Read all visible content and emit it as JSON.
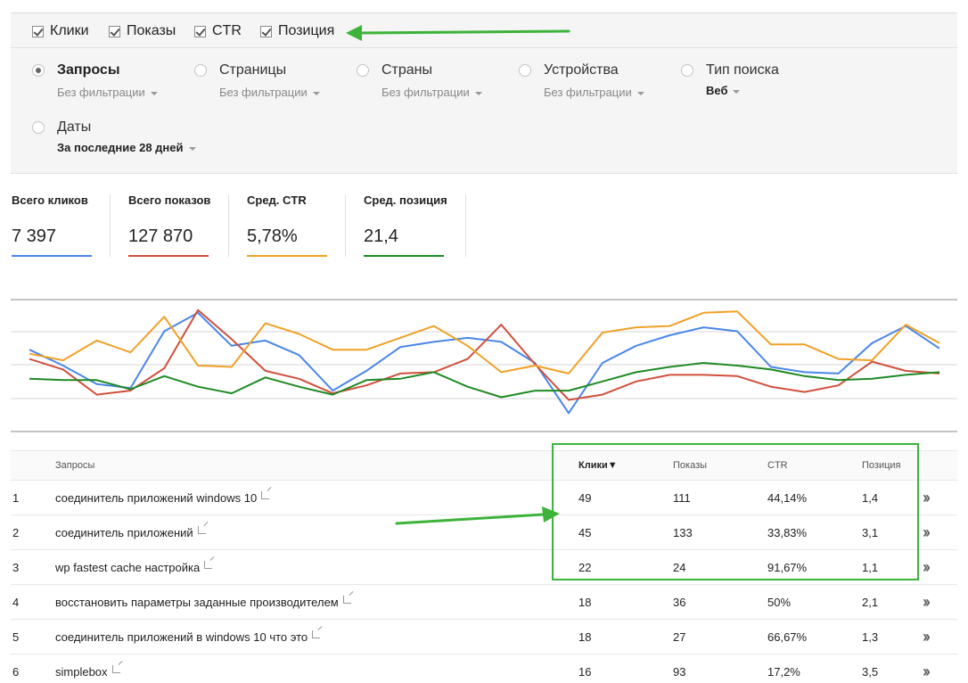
{
  "metrics": [
    {
      "label": "Клики",
      "checked": true
    },
    {
      "label": "Показы",
      "checked": true
    },
    {
      "label": "CTR",
      "checked": true
    },
    {
      "label": "Позиция",
      "checked": true
    }
  ],
  "dimensions": [
    {
      "label": "Запросы",
      "sub": "Без фильтрации",
      "selected": true
    },
    {
      "label": "Страницы",
      "sub": "Без фильтрации",
      "selected": false
    },
    {
      "label": "Страны",
      "sub": "Без фильтрации",
      "selected": false
    },
    {
      "label": "Устройства",
      "sub": "Без фильтрации",
      "selected": false
    },
    {
      "label": "Тип поиска",
      "sub": "Веб",
      "selected": false
    },
    {
      "label": "Даты",
      "sub": "За последние 28 дней",
      "selected": false
    }
  ],
  "totals": [
    {
      "label": "Всего кликов",
      "value": "7 397",
      "color": "#4a86e8"
    },
    {
      "label": "Всего показов",
      "value": "127 870",
      "color": "#d0503e"
    },
    {
      "label": "Сред. CTR",
      "value": "5,78%",
      "color": "#f0a127"
    },
    {
      "label": "Сред. позиция",
      "value": "21,4",
      "color": "#1f8a24"
    }
  ],
  "chart_data": {
    "type": "line",
    "x": [
      1,
      2,
      3,
      4,
      5,
      6,
      7,
      8,
      9,
      10,
      11,
      12,
      13,
      14,
      15,
      16,
      17,
      18,
      19,
      20,
      21,
      22,
      23,
      24,
      25,
      26,
      27,
      28
    ],
    "series": [
      {
        "name": "Клики",
        "color": "#4a86e8",
        "values": [
          0.62,
          0.5,
          0.36,
          0.33,
          0.76,
          0.9,
          0.65,
          0.69,
          0.58,
          0.31,
          0.46,
          0.64,
          0.68,
          0.71,
          0.68,
          0.52,
          0.14,
          0.52,
          0.65,
          0.73,
          0.79,
          0.76,
          0.49,
          0.45,
          0.44,
          0.67,
          0.8,
          0.63
        ]
      },
      {
        "name": "Показы",
        "color": "#d0503e",
        "values": [
          0.55,
          0.47,
          0.28,
          0.31,
          0.48,
          0.92,
          0.7,
          0.46,
          0.4,
          0.29,
          0.35,
          0.44,
          0.45,
          0.55,
          0.81,
          0.51,
          0.24,
          0.28,
          0.38,
          0.43,
          0.43,
          0.42,
          0.34,
          0.3,
          0.35,
          0.53,
          0.46,
          0.44
        ]
      },
      {
        "name": "CTR",
        "color": "#f0a127",
        "values": [
          0.59,
          0.54,
          0.69,
          0.6,
          0.87,
          0.5,
          0.49,
          0.82,
          0.74,
          0.62,
          0.62,
          0.71,
          0.8,
          0.65,
          0.45,
          0.5,
          0.44,
          0.75,
          0.79,
          0.8,
          0.9,
          0.91,
          0.66,
          0.66,
          0.55,
          0.54,
          0.81,
          0.67
        ]
      },
      {
        "name": "Позиция",
        "color": "#1f8a24",
        "values": [
          0.4,
          0.39,
          0.39,
          0.32,
          0.42,
          0.34,
          0.29,
          0.41,
          0.34,
          0.28,
          0.39,
          0.4,
          0.45,
          0.34,
          0.26,
          0.31,
          0.31,
          0.38,
          0.45,
          0.49,
          0.52,
          0.5,
          0.47,
          0.42,
          0.39,
          0.4,
          0.43,
          0.45
        ]
      }
    ],
    "ylim": [
      0,
      1
    ],
    "grid": true
  },
  "table": {
    "headers": {
      "query": "Запросы",
      "clicks": "Клики",
      "impressions": "Показы",
      "ctr": "CTR",
      "position": "Позиция"
    },
    "sort_marker": "▼",
    "rows": [
      {
        "idx": "1",
        "query": "соединитель приложений windows 10",
        "clicks": "49",
        "impressions": "111",
        "ctr": "44,14%",
        "position": "1,4"
      },
      {
        "idx": "2",
        "query": "соединитель приложений",
        "clicks": "45",
        "impressions": "133",
        "ctr": "33,83%",
        "position": "3,1"
      },
      {
        "idx": "3",
        "query": "wp fastest cache настройка",
        "clicks": "22",
        "impressions": "24",
        "ctr": "91,67%",
        "position": "1,1"
      },
      {
        "idx": "4",
        "query": "восстановить параметры заданные производителем",
        "clicks": "18",
        "impressions": "36",
        "ctr": "50%",
        "position": "2,1"
      },
      {
        "idx": "5",
        "query": "соединитель приложений в windows 10 что это",
        "clicks": "18",
        "impressions": "27",
        "ctr": "66,67%",
        "position": "1,3"
      },
      {
        "idx": "6",
        "query": "simplebox",
        "clicks": "16",
        "impressions": "93",
        "ctr": "17,2%",
        "position": "3,5"
      }
    ]
  },
  "accent": "#3db33a"
}
